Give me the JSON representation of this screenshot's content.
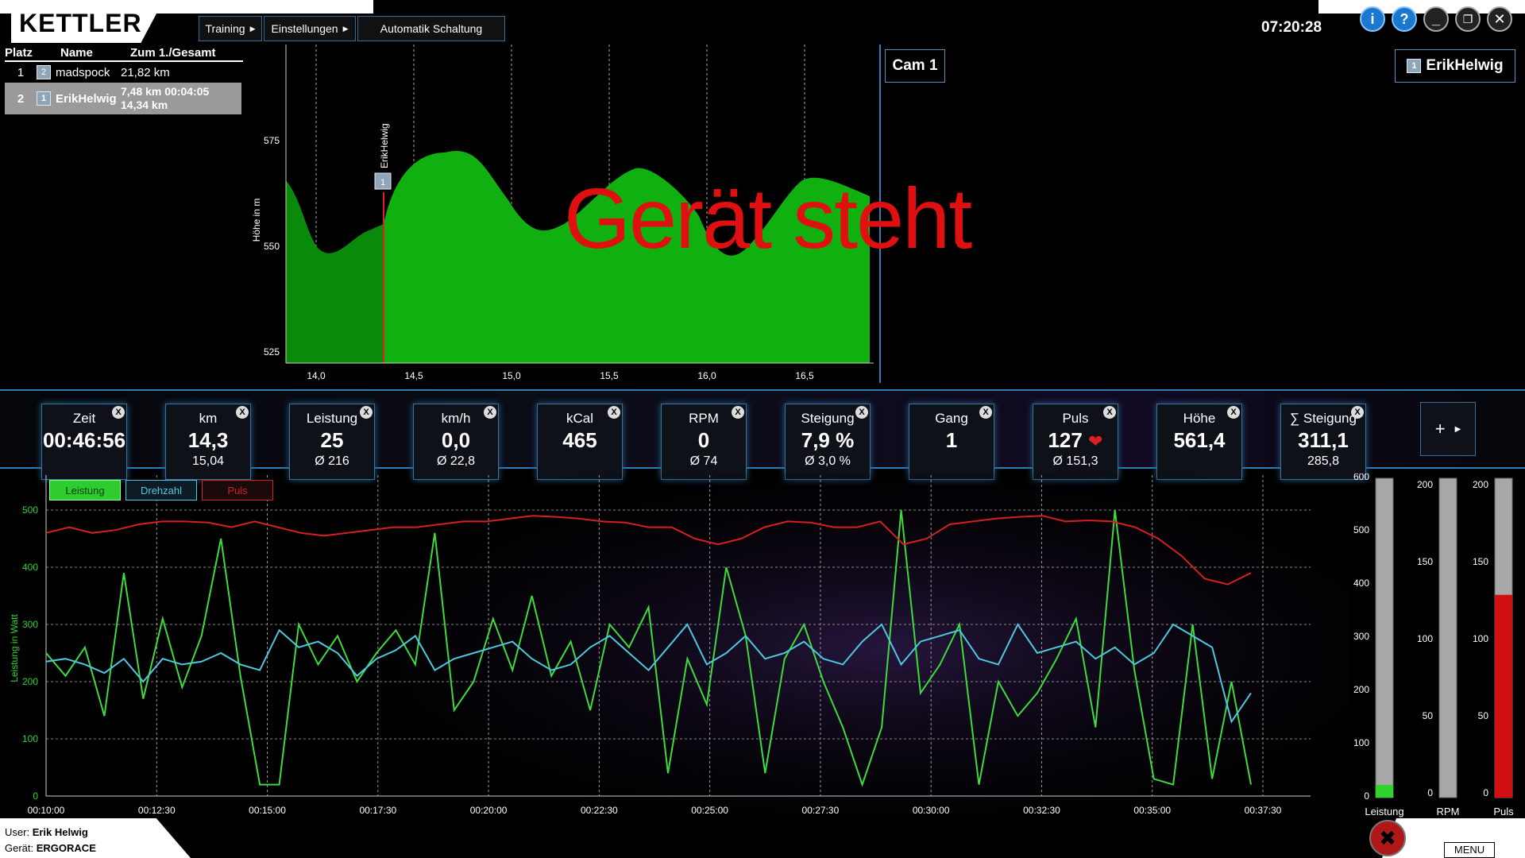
{
  "app": {
    "logo": "KETTLER",
    "clock": "07:20:28"
  },
  "menu": {
    "training": "Training",
    "einstellungen": "Einstellungen",
    "automatik": "Automatik Schaltung"
  },
  "window_buttons": [
    "info-icon",
    "help-icon",
    "minimize-icon",
    "restore-icon",
    "close-icon"
  ],
  "ranking": {
    "headers": {
      "platz": "Platz",
      "name": "Name",
      "distance": "Zum 1./Gesamt"
    },
    "rows": [
      {
        "place": "1",
        "badge": "2",
        "name": "madspock",
        "line1": "21,82 km",
        "line2": ""
      },
      {
        "place": "2",
        "badge": "1",
        "name": "ErikHelwig",
        "line1": "7,48 km 00:04:05",
        "line2": "14,34 km"
      }
    ]
  },
  "elevation": {
    "ylabel": "Höhe in m",
    "yticks": [
      "575",
      "550",
      "525"
    ],
    "xticks": [
      "14,0",
      "14,5",
      "15,0",
      "15,5",
      "16,0",
      "16,5"
    ],
    "rider_label": "ErikHelwig",
    "rider_badge": "1",
    "overlay_text": "Gerät steht"
  },
  "cam": {
    "label": "Cam 1"
  },
  "current_user": {
    "badge": "1",
    "name": "ErikHelwig"
  },
  "metrics": [
    {
      "label": "Zeit",
      "value": "00:46:56",
      "avg": ""
    },
    {
      "label": "km",
      "value": "14,3",
      "avg": "15,04"
    },
    {
      "label": "Leistung",
      "value": "25",
      "avg": "Ø 216"
    },
    {
      "label": "km/h",
      "value": "0,0",
      "avg": "Ø 22,8"
    },
    {
      "label": "kCal",
      "value": "465",
      "avg": ""
    },
    {
      "label": "RPM",
      "value": "0",
      "avg": "Ø 74"
    },
    {
      "label": "Steigung",
      "value": "7,9 %",
      "avg": "Ø 3,0 %"
    },
    {
      "label": "Gang",
      "value": "1",
      "avg": ""
    },
    {
      "label": "Puls",
      "value": "127",
      "avg": "Ø 151,3"
    },
    {
      "label": "Höhe",
      "value": "561,4",
      "avg": ""
    },
    {
      "label": "∑ Steigung",
      "value": "311,1",
      "avg": "285,8"
    }
  ],
  "metric_close": "X",
  "add_metric": "+",
  "chart_legend": {
    "leistung": "Leistung",
    "drehzahl": "Drehzahl",
    "puls": "Puls"
  },
  "chart_colors": {
    "leistung": "#3ddc3d",
    "drehzahl": "#4ec8e0",
    "puls": "#d42020"
  },
  "chart_data": {
    "type": "line",
    "ylabel": "Leistung in Watt",
    "ylim": [
      0,
      550
    ],
    "yticks_left": [
      "500",
      "400",
      "300",
      "200",
      "100",
      "0"
    ],
    "yticks_right": [
      "600",
      "500",
      "400",
      "300",
      "200",
      "100",
      "0"
    ],
    "xticks": [
      "00:10:00",
      "00:12:30",
      "00:15:00",
      "00:17:30",
      "00:20:00",
      "00:22:30",
      "00:25:00",
      "00:27:30",
      "00:30:00",
      "00:32:30",
      "00:35:00",
      "00:37:30"
    ],
    "series": [
      {
        "name": "Leistung",
        "values": [
          250,
          210,
          260,
          140,
          390,
          170,
          310,
          190,
          280,
          450,
          210,
          20,
          20,
          300,
          230,
          280,
          200,
          250,
          290,
          230,
          460,
          150,
          200,
          310,
          220,
          350,
          210,
          270,
          150,
          300,
          260,
          330,
          40,
          240,
          160,
          400,
          280,
          40,
          240,
          300,
          200,
          120,
          20,
          120,
          500,
          180,
          230,
          300,
          20,
          200,
          140,
          180,
          240,
          310,
          120,
          500,
          220,
          30,
          20,
          300,
          30,
          200,
          20
        ]
      },
      {
        "name": "Drehzahl",
        "values": [
          235,
          240,
          230,
          215,
          240,
          200,
          240,
          230,
          235,
          250,
          230,
          220,
          290,
          260,
          270,
          250,
          210,
          240,
          255,
          280,
          220,
          240,
          250,
          260,
          270,
          240,
          220,
          230,
          260,
          280,
          250,
          220,
          260,
          300,
          230,
          250,
          280,
          240,
          250,
          270,
          240,
          230,
          270,
          300,
          230,
          270,
          280,
          290,
          240,
          230,
          300,
          250,
          260,
          270,
          240,
          260,
          230,
          250,
          300,
          280,
          260,
          130,
          180
        ]
      },
      {
        "name": "Puls",
        "values": [
          460,
          470,
          460,
          465,
          475,
          480,
          480,
          478,
          470,
          480,
          470,
          460,
          455,
          460,
          465,
          470,
          470,
          475,
          480,
          480,
          485,
          490,
          488,
          485,
          480,
          478,
          470,
          470,
          450,
          440,
          450,
          470,
          480,
          478,
          470,
          470,
          480,
          440,
          450,
          475,
          480,
          485,
          488,
          490,
          480,
          482,
          480,
          470,
          450,
          420,
          380,
          370,
          390
        ]
      }
    ]
  },
  "gauges": [
    {
      "label": "Leistung",
      "ticks": [
        "600",
        "500",
        "400",
        "300",
        "200",
        "100",
        "0"
      ],
      "fraction": 0.04,
      "color": "#2fd22f"
    },
    {
      "label": "RPM",
      "ticks": [
        "200",
        "150",
        "100",
        "50",
        "0"
      ],
      "fraction": 0.0,
      "color": "#4ec8e0"
    },
    {
      "label": "Puls",
      "ticks": [
        "200",
        "150",
        "100",
        "50",
        "0"
      ],
      "fraction": 0.635,
      "color": "#d01010"
    }
  ],
  "footer": {
    "user_label": "User:",
    "user_value": "Erik Helwig",
    "device_label": "Gerät:",
    "device_value": "ERGORACE",
    "menu_label": "MENU"
  }
}
